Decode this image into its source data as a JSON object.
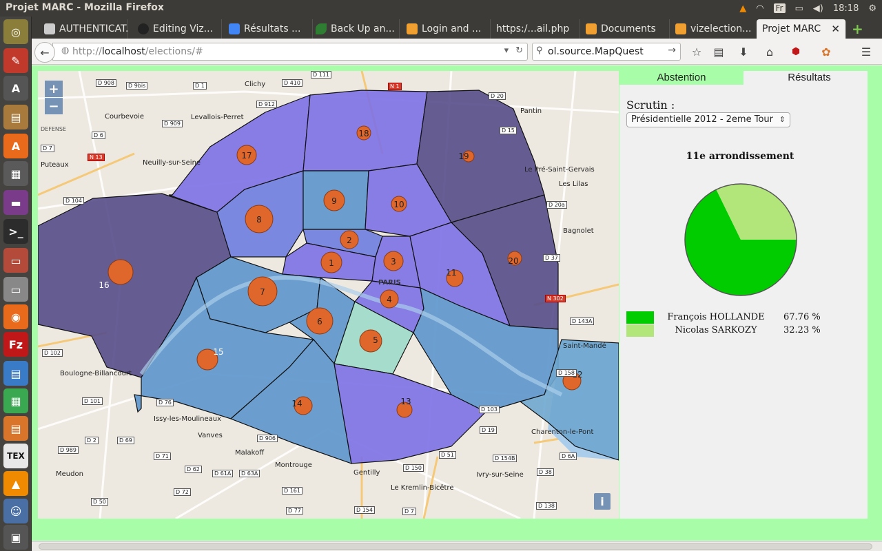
{
  "system": {
    "window_title": "Projet MARC - Mozilla Firefox",
    "keyboard": "Fr",
    "clock": "18:18"
  },
  "browser": {
    "tabs": [
      {
        "label": "AUTHENTICAT...",
        "icon": "doc-icon",
        "color": "#cccccc"
      },
      {
        "label": "Editing Viz...",
        "icon": "github-icon",
        "color": "#222222"
      },
      {
        "label": "Résultats ...",
        "icon": "google-icon",
        "color": "#4285f4"
      },
      {
        "label": "Back Up an...",
        "icon": "leaf-icon",
        "color": "#2e7d32"
      },
      {
        "label": "Login and ...",
        "icon": "bucket-icon",
        "color": "#f0a030"
      },
      {
        "label": "https:/...ail.php",
        "icon": "blank-icon",
        "color": "#3c3b37"
      },
      {
        "label": "Documents",
        "icon": "bucket-icon",
        "color": "#f0a030"
      },
      {
        "label": "vizelection...",
        "icon": "bucket-icon",
        "color": "#f0a030"
      },
      {
        "label": "Projet MARC",
        "icon": "blank-icon",
        "color": "#f2f1f0"
      }
    ],
    "url_prefix": "http://",
    "url_host": "localhost",
    "url_path": "/elections/#",
    "search_value": "ol.source.MapQuest"
  },
  "map": {
    "zoom_in": "+",
    "zoom_out": "−",
    "info": "i",
    "colors": {
      "water": "#a9cdeb",
      "park": "#b7d6a5",
      "dark": "#554c8a",
      "violet": "#7c70e6",
      "mid": "#6d7de0",
      "blue": "#5c95cc",
      "lightblue": "#6fa7d0",
      "mint": "#a2dbc9",
      "circle": "#e0672c"
    },
    "place_labels": [
      "Clichy",
      "Levallois-Perret",
      "Courbevoie",
      "Neuilly-sur-Seine",
      "Puteaux",
      "Pantin",
      "Le Pré-Saint-Gervais",
      "Les Lilas",
      "Bagnolet",
      "Saint-Mandé",
      "Boulogne-Billancourt",
      "Issy-les-Moulineaux",
      "Vanves",
      "Malakoff",
      "Montrouge",
      "Gentilly",
      "Le Kremlin-Bicêtre",
      "Ivry-sur-Seine",
      "Charenton-le-Pont",
      "Meudon",
      "PARIS",
      "DEFENSE"
    ],
    "road_labels": [
      "D 908",
      "D 9bis",
      "D 1",
      "D 410",
      "D 111",
      "N 1",
      "D 20",
      "D 912",
      "D 909",
      "D 6",
      "D 7",
      "N 13",
      "D 104",
      "D 15",
      "D 20a",
      "D 37",
      "N 302",
      "D 143A",
      "D 102",
      "D 101",
      "D 76",
      "D 2",
      "D 69",
      "D 989",
      "D 71",
      "D 62",
      "D 61A",
      "D 63A",
      "D 72",
      "D 161",
      "D 77",
      "D 154",
      "D 7",
      "D 150",
      "D 51",
      "D 154B",
      "D 38",
      "D 138",
      "D 19",
      "D 103",
      "D 6A",
      "D 906",
      "D 158",
      "D 50"
    ],
    "arrondissements": [
      "1",
      "2",
      "3",
      "4",
      "5",
      "6",
      "7",
      "8",
      "9",
      "10",
      "11",
      "12",
      "13",
      "14",
      "15",
      "16",
      "17",
      "18",
      "19",
      "20"
    ]
  },
  "panel": {
    "tab_abstention": "Abstention",
    "tab_results": "Résultats",
    "scrutin_label": "Scrutin :",
    "scrutin_value": "Présidentielle 2012 - 2eme Tour",
    "arr_title": "11e arrondissement",
    "results": [
      {
        "name": "François HOLLANDE",
        "percent": "67.76 %",
        "share": 67.76,
        "color": "#00cc00"
      },
      {
        "name": "Nicolas SARKOZY",
        "percent": "32.23 %",
        "share": 32.23,
        "color": "#b3e67a"
      }
    ]
  }
}
